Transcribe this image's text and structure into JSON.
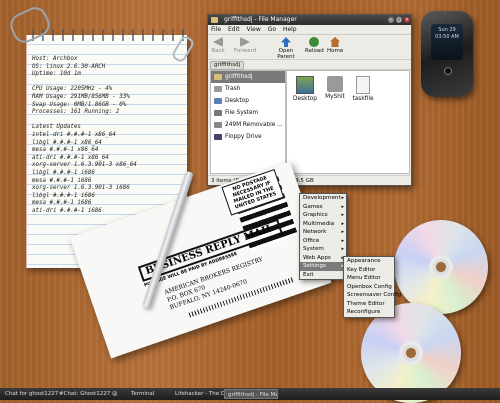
{
  "notepad": {
    "lines": [
      "Host: Archbox",
      "OS: linux 2.6.30-ARCH",
      "Uptime: 10d 1m",
      "",
      "CPU Usage: 2205MHz - 4%",
      "RAM Usage: 291MB/856MB - 33%",
      "Swap Usage: 0MB/1.86GB - 0%",
      "Processes: 161    Running: 2",
      "",
      "Latest Updates",
      "intel-dri #.#.#-1 x86_64",
      "libgl #.#.#-1 x86_64",
      "mesa #.#.#-1 x86_64",
      "ati-dri #.#.#-1 x86_64",
      "xorg-server 1.6.3.901-3 x86_64",
      "libgl #.#.#-1 i686",
      "mesa #.#.#-1 i686",
      "xorg-server 1.6.3.901-3 i686",
      "libgl #.#.#-1 i686",
      "mesa #.#.#-1 i686",
      "ati-dri #.#.#-1 i686"
    ]
  },
  "file_manager": {
    "title": "griffithsdj - File Manager",
    "menu": [
      "File",
      "Edit",
      "View",
      "Go",
      "Help"
    ],
    "toolbar": {
      "back": "Back",
      "forward": "Forward",
      "open_parent": "Open Parent",
      "reload": "Reload",
      "home": "Home"
    },
    "location": "griffithsdj",
    "sidebar": [
      "griffithsdj",
      "Trash",
      "Desktop",
      "File System",
      "249M Removable ...",
      "Floppy Drive"
    ],
    "files": [
      "Desktop",
      "MyShit",
      "taskfile"
    ],
    "status": "3 items (8.0 kB), Free space: 39.5 GB"
  },
  "phone": {
    "day": "Sun 29",
    "time": "03:50 AM"
  },
  "envelope": {
    "stamp": "NO POSTAGE NECESSARY IF MAILED IN THE UNITED STATES",
    "title": "BUSINESS REPLY MAIL",
    "subtitle": "POSTAGE WILL BE PAID BY ADDRESSEE",
    "address": [
      "AMERICAN BROKERS REGISTRY",
      "P.O. BOX 670",
      "BUFFALO, NY 14240-0670"
    ]
  },
  "menu_main": [
    "Development",
    "Games",
    "Graphics",
    "Multimedia",
    "Network",
    "Office",
    "System",
    "Web Apps",
    "Settings",
    "Exit"
  ],
  "menu_main_submenus": [
    "Development",
    "Games",
    "Graphics",
    "Multimedia",
    "Network",
    "Office",
    "System",
    "Web Apps",
    "Settings"
  ],
  "menu_settings": [
    "Appearance",
    "Key Editor",
    "Menu Editor",
    "Openbox Config",
    "Screensaver Config",
    "Theme Editor",
    "Reconfigure"
  ],
  "taskbar": [
    "Chat for ghost1227",
    "#Chat: Ghost1227 @",
    "Terminal",
    "Lifehacker - The Dav",
    "griffithsdj - File Man..."
  ],
  "colors": {
    "desk": "#a86530",
    "menu_selected": "#7a7a7a",
    "titlebar": "#2c2c2c"
  }
}
